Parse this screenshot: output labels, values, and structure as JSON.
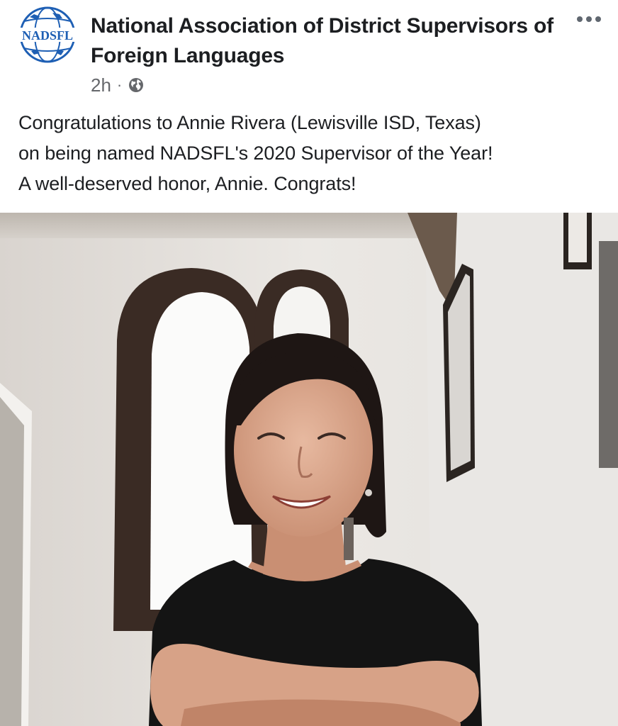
{
  "post": {
    "page_name": "National Association of District Supervisors of Foreign Languages",
    "avatar_text": "NADSFL",
    "timestamp": "2h",
    "separator": "·",
    "privacy_icon": "globe-icon",
    "more_icon": "more-options-icon",
    "body": "Congratulations to Annie Rivera (Lewisville ISD, Texas)\non being named NADSFL's 2020 Supervisor of the Year!\nA well-deserved honor, Annie. Congrats!",
    "photo": {
      "icon": "photo-image"
    }
  },
  "colors": {
    "text_primary": "#1c1e21",
    "text_secondary": "#65676b",
    "logo_blue": "#1e5fb4"
  }
}
